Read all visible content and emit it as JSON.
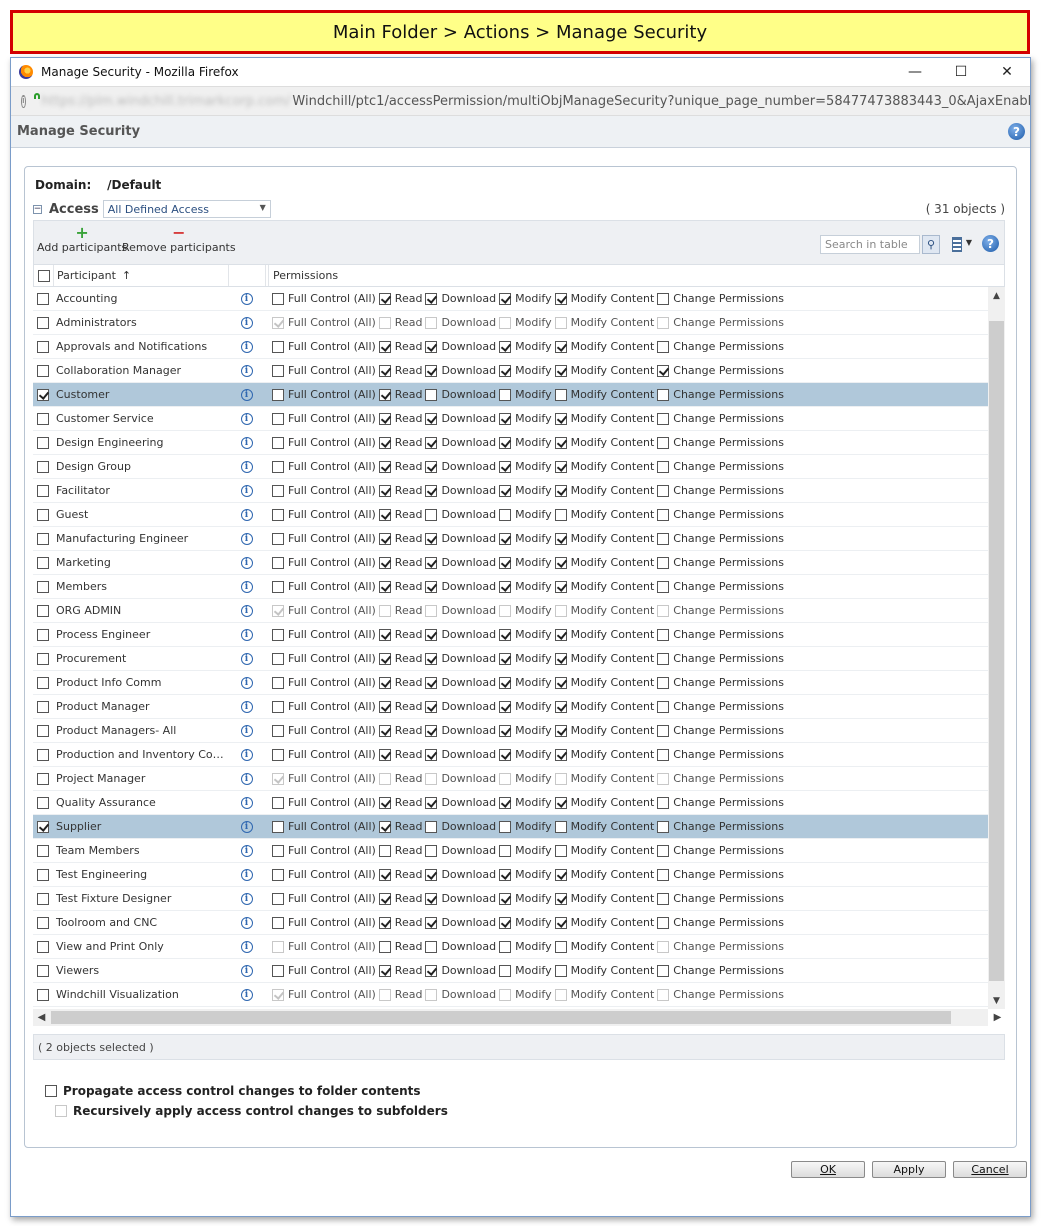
{
  "banner": {
    "text": "Main Folder > Actions > Manage Security"
  },
  "browser": {
    "title": "Manage Security - Mozilla Firefox",
    "url_host": "https://plm.windchill.trimarkcorp.com/",
    "url_path": "Windchill/ptc1/accessPermission/multiObjManageSecurity?unique_page_number=58477473883443_0&AjaxEnabled=c",
    "controls": {
      "minimize": "—",
      "maximize": "☐",
      "close": "✕"
    }
  },
  "dialog": {
    "title": "Manage Security",
    "domain_label": "Domain:",
    "domain_value": "/Default",
    "access_label": "Access",
    "access_select": "All Defined Access",
    "object_count": "( 31 objects )",
    "toolbar": {
      "add_label": "Add participants",
      "remove_label": "Remove participants",
      "search_placeholder": "Search in table"
    },
    "columns": {
      "participant": "Participant",
      "sort_indicator": "↑",
      "permissions": "Permissions"
    },
    "perm_labels": [
      "Full Control (All)",
      "Read",
      "Download",
      "Modify",
      "Modify Content",
      "Change Permissions"
    ],
    "status": "( 2 objects selected )",
    "options": {
      "propagate": "Propagate access control changes to folder contents",
      "recursive": "Recursively apply access control changes to subfolders"
    },
    "buttons": {
      "ok": "OK",
      "apply": "Apply",
      "cancel": "Cancel"
    }
  },
  "rows": [
    {
      "name": "Accounting",
      "selected": false,
      "disabled": false,
      "perms": [
        0,
        1,
        1,
        1,
        1,
        0
      ]
    },
    {
      "name": "Administrators",
      "selected": false,
      "disabled": true,
      "perms": [
        1,
        0,
        0,
        0,
        0,
        0
      ]
    },
    {
      "name": "Approvals and Notifications",
      "selected": false,
      "disabled": false,
      "perms": [
        0,
        1,
        1,
        1,
        1,
        0
      ]
    },
    {
      "name": "Collaboration Manager",
      "selected": false,
      "disabled": false,
      "perms": [
        0,
        1,
        1,
        1,
        1,
        1
      ]
    },
    {
      "name": "Customer",
      "selected": true,
      "disabled": false,
      "perms": [
        0,
        1,
        0,
        0,
        0,
        0
      ]
    },
    {
      "name": "Customer Service",
      "selected": false,
      "disabled": false,
      "perms": [
        0,
        1,
        1,
        1,
        1,
        0
      ]
    },
    {
      "name": "Design Engineering",
      "selected": false,
      "disabled": false,
      "perms": [
        0,
        1,
        1,
        1,
        1,
        0
      ]
    },
    {
      "name": "Design Group",
      "selected": false,
      "disabled": false,
      "perms": [
        0,
        1,
        1,
        1,
        1,
        0
      ]
    },
    {
      "name": "Facilitator",
      "selected": false,
      "disabled": false,
      "perms": [
        0,
        1,
        1,
        1,
        1,
        0
      ]
    },
    {
      "name": "Guest",
      "selected": false,
      "disabled": false,
      "perms": [
        0,
        1,
        0,
        0,
        0,
        0
      ]
    },
    {
      "name": "Manufacturing Engineer",
      "selected": false,
      "disabled": false,
      "perms": [
        0,
        1,
        1,
        1,
        1,
        0
      ]
    },
    {
      "name": "Marketing",
      "selected": false,
      "disabled": false,
      "perms": [
        0,
        1,
        1,
        1,
        1,
        0
      ]
    },
    {
      "name": "Members",
      "selected": false,
      "disabled": false,
      "perms": [
        0,
        1,
        1,
        1,
        1,
        0
      ]
    },
    {
      "name": "ORG ADMIN",
      "selected": false,
      "disabled": true,
      "perms": [
        1,
        0,
        0,
        0,
        0,
        0
      ]
    },
    {
      "name": "Process Engineer",
      "selected": false,
      "disabled": false,
      "perms": [
        0,
        1,
        1,
        1,
        1,
        0
      ]
    },
    {
      "name": "Procurement",
      "selected": false,
      "disabled": false,
      "perms": [
        0,
        1,
        1,
        1,
        1,
        0
      ]
    },
    {
      "name": "Product Info Comm",
      "selected": false,
      "disabled": false,
      "perms": [
        0,
        1,
        1,
        1,
        1,
        0
      ]
    },
    {
      "name": "Product Manager",
      "selected": false,
      "disabled": false,
      "perms": [
        0,
        1,
        1,
        1,
        1,
        0
      ]
    },
    {
      "name": "Product Managers- All",
      "selected": false,
      "disabled": false,
      "perms": [
        0,
        1,
        1,
        1,
        1,
        0
      ]
    },
    {
      "name": "Production and Inventory Cont...",
      "selected": false,
      "disabled": false,
      "perms": [
        0,
        1,
        1,
        1,
        1,
        0
      ]
    },
    {
      "name": "Project Manager",
      "selected": false,
      "disabled": true,
      "perms": [
        1,
        0,
        0,
        0,
        0,
        0
      ]
    },
    {
      "name": "Quality Assurance",
      "selected": false,
      "disabled": false,
      "perms": [
        0,
        1,
        1,
        1,
        1,
        0
      ]
    },
    {
      "name": "Supplier",
      "selected": true,
      "disabled": false,
      "perms": [
        0,
        1,
        0,
        0,
        0,
        0
      ]
    },
    {
      "name": "Team Members",
      "selected": false,
      "disabled": false,
      "perms": [
        0,
        0,
        0,
        0,
        0,
        0
      ]
    },
    {
      "name": "Test Engineering",
      "selected": false,
      "disabled": false,
      "perms": [
        0,
        1,
        1,
        1,
        1,
        0
      ]
    },
    {
      "name": "Test Fixture Designer",
      "selected": false,
      "disabled": false,
      "perms": [
        0,
        1,
        1,
        1,
        1,
        0
      ]
    },
    {
      "name": "Toolroom and CNC",
      "selected": false,
      "disabled": false,
      "perms": [
        0,
        1,
        1,
        1,
        1,
        0
      ]
    },
    {
      "name": "View and Print Only",
      "selected": false,
      "disabled": false,
      "special": "viewprint",
      "perms": [
        0,
        0,
        0,
        0,
        0,
        0
      ]
    },
    {
      "name": "Viewers",
      "selected": false,
      "disabled": false,
      "perms": [
        0,
        1,
        1,
        0,
        0,
        0
      ]
    },
    {
      "name": "Windchill Visualization",
      "selected": false,
      "disabled": true,
      "perms": [
        1,
        0,
        0,
        0,
        0,
        0
      ]
    }
  ]
}
